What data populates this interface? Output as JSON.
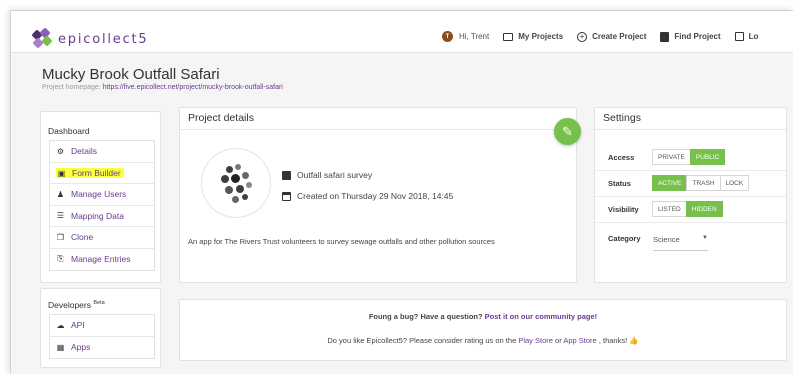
{
  "app": {
    "logo_text": "epicollect5",
    "brand_color": "#673c90",
    "accent_green": "#76c04b",
    "highlight_color": "#fbff3c"
  },
  "nav": {
    "avatar_initial": "T",
    "greeting": "Hi, Trent",
    "items": [
      {
        "label": "My Projects",
        "icon": "folder-icon"
      },
      {
        "label": "Create Project",
        "icon": "plus-circle-icon"
      },
      {
        "label": "Find Project",
        "icon": "search-icon"
      },
      {
        "label": "Lo",
        "icon": "login-icon"
      }
    ]
  },
  "project": {
    "title": "Mucky Brook Outfall Safari",
    "homepage_label": "Project homepage:",
    "homepage_url": "https://five.epicollect.net/project/mucky-brook-outfall-safari"
  },
  "sidebar": {
    "dashboard_heading": "Dashboard",
    "items": [
      {
        "label": "Details",
        "icon": "gear-icon"
      },
      {
        "label": "Form Builder",
        "icon": "form-icon",
        "highlighted": true
      },
      {
        "label": "Manage Users",
        "icon": "users-icon"
      },
      {
        "label": "Mapping Data",
        "icon": "list-icon"
      },
      {
        "label": "Clone",
        "icon": "copy-icon"
      },
      {
        "label": "Manage Entries",
        "icon": "entries-icon"
      }
    ],
    "developers_heading": "Developers",
    "developers_badge": "Beta",
    "dev_items": [
      {
        "label": "API",
        "icon": "cloud-icon"
      },
      {
        "label": "Apps",
        "icon": "grid-icon"
      }
    ]
  },
  "details": {
    "heading": "Project details",
    "edit_icon": "pencil-icon",
    "small_description": "Outfall safari survey",
    "created": "Created on Thursday 29 Nov 2018, 14:45",
    "description": "An app for The Rivers Trust volunteers to survey sewage outfalls and other pollution sources"
  },
  "settings": {
    "heading": "Settings",
    "access": {
      "label": "Access",
      "options": [
        "PRIVATE",
        "PUBLIC"
      ],
      "selected": "PUBLIC"
    },
    "status": {
      "label": "Status",
      "options": [
        "ACTIVE",
        "TRASH",
        "LOCK"
      ],
      "selected": "ACTIVE"
    },
    "visibility": {
      "label": "Visibility",
      "options": [
        "LISTED",
        "HIDDEN"
      ],
      "selected": "HIDDEN"
    },
    "category": {
      "label": "Category",
      "value": "Science"
    }
  },
  "feedback": {
    "bug_text": "Foung a bug? Have a question?",
    "bug_link": "Post it on our community page!",
    "rate_prefix": "Do you like Epicollect5? Please consider rating us on the",
    "play_store": "Play Store",
    "or": "or",
    "app_store": "App Store",
    "thanks": ", thanks!"
  }
}
